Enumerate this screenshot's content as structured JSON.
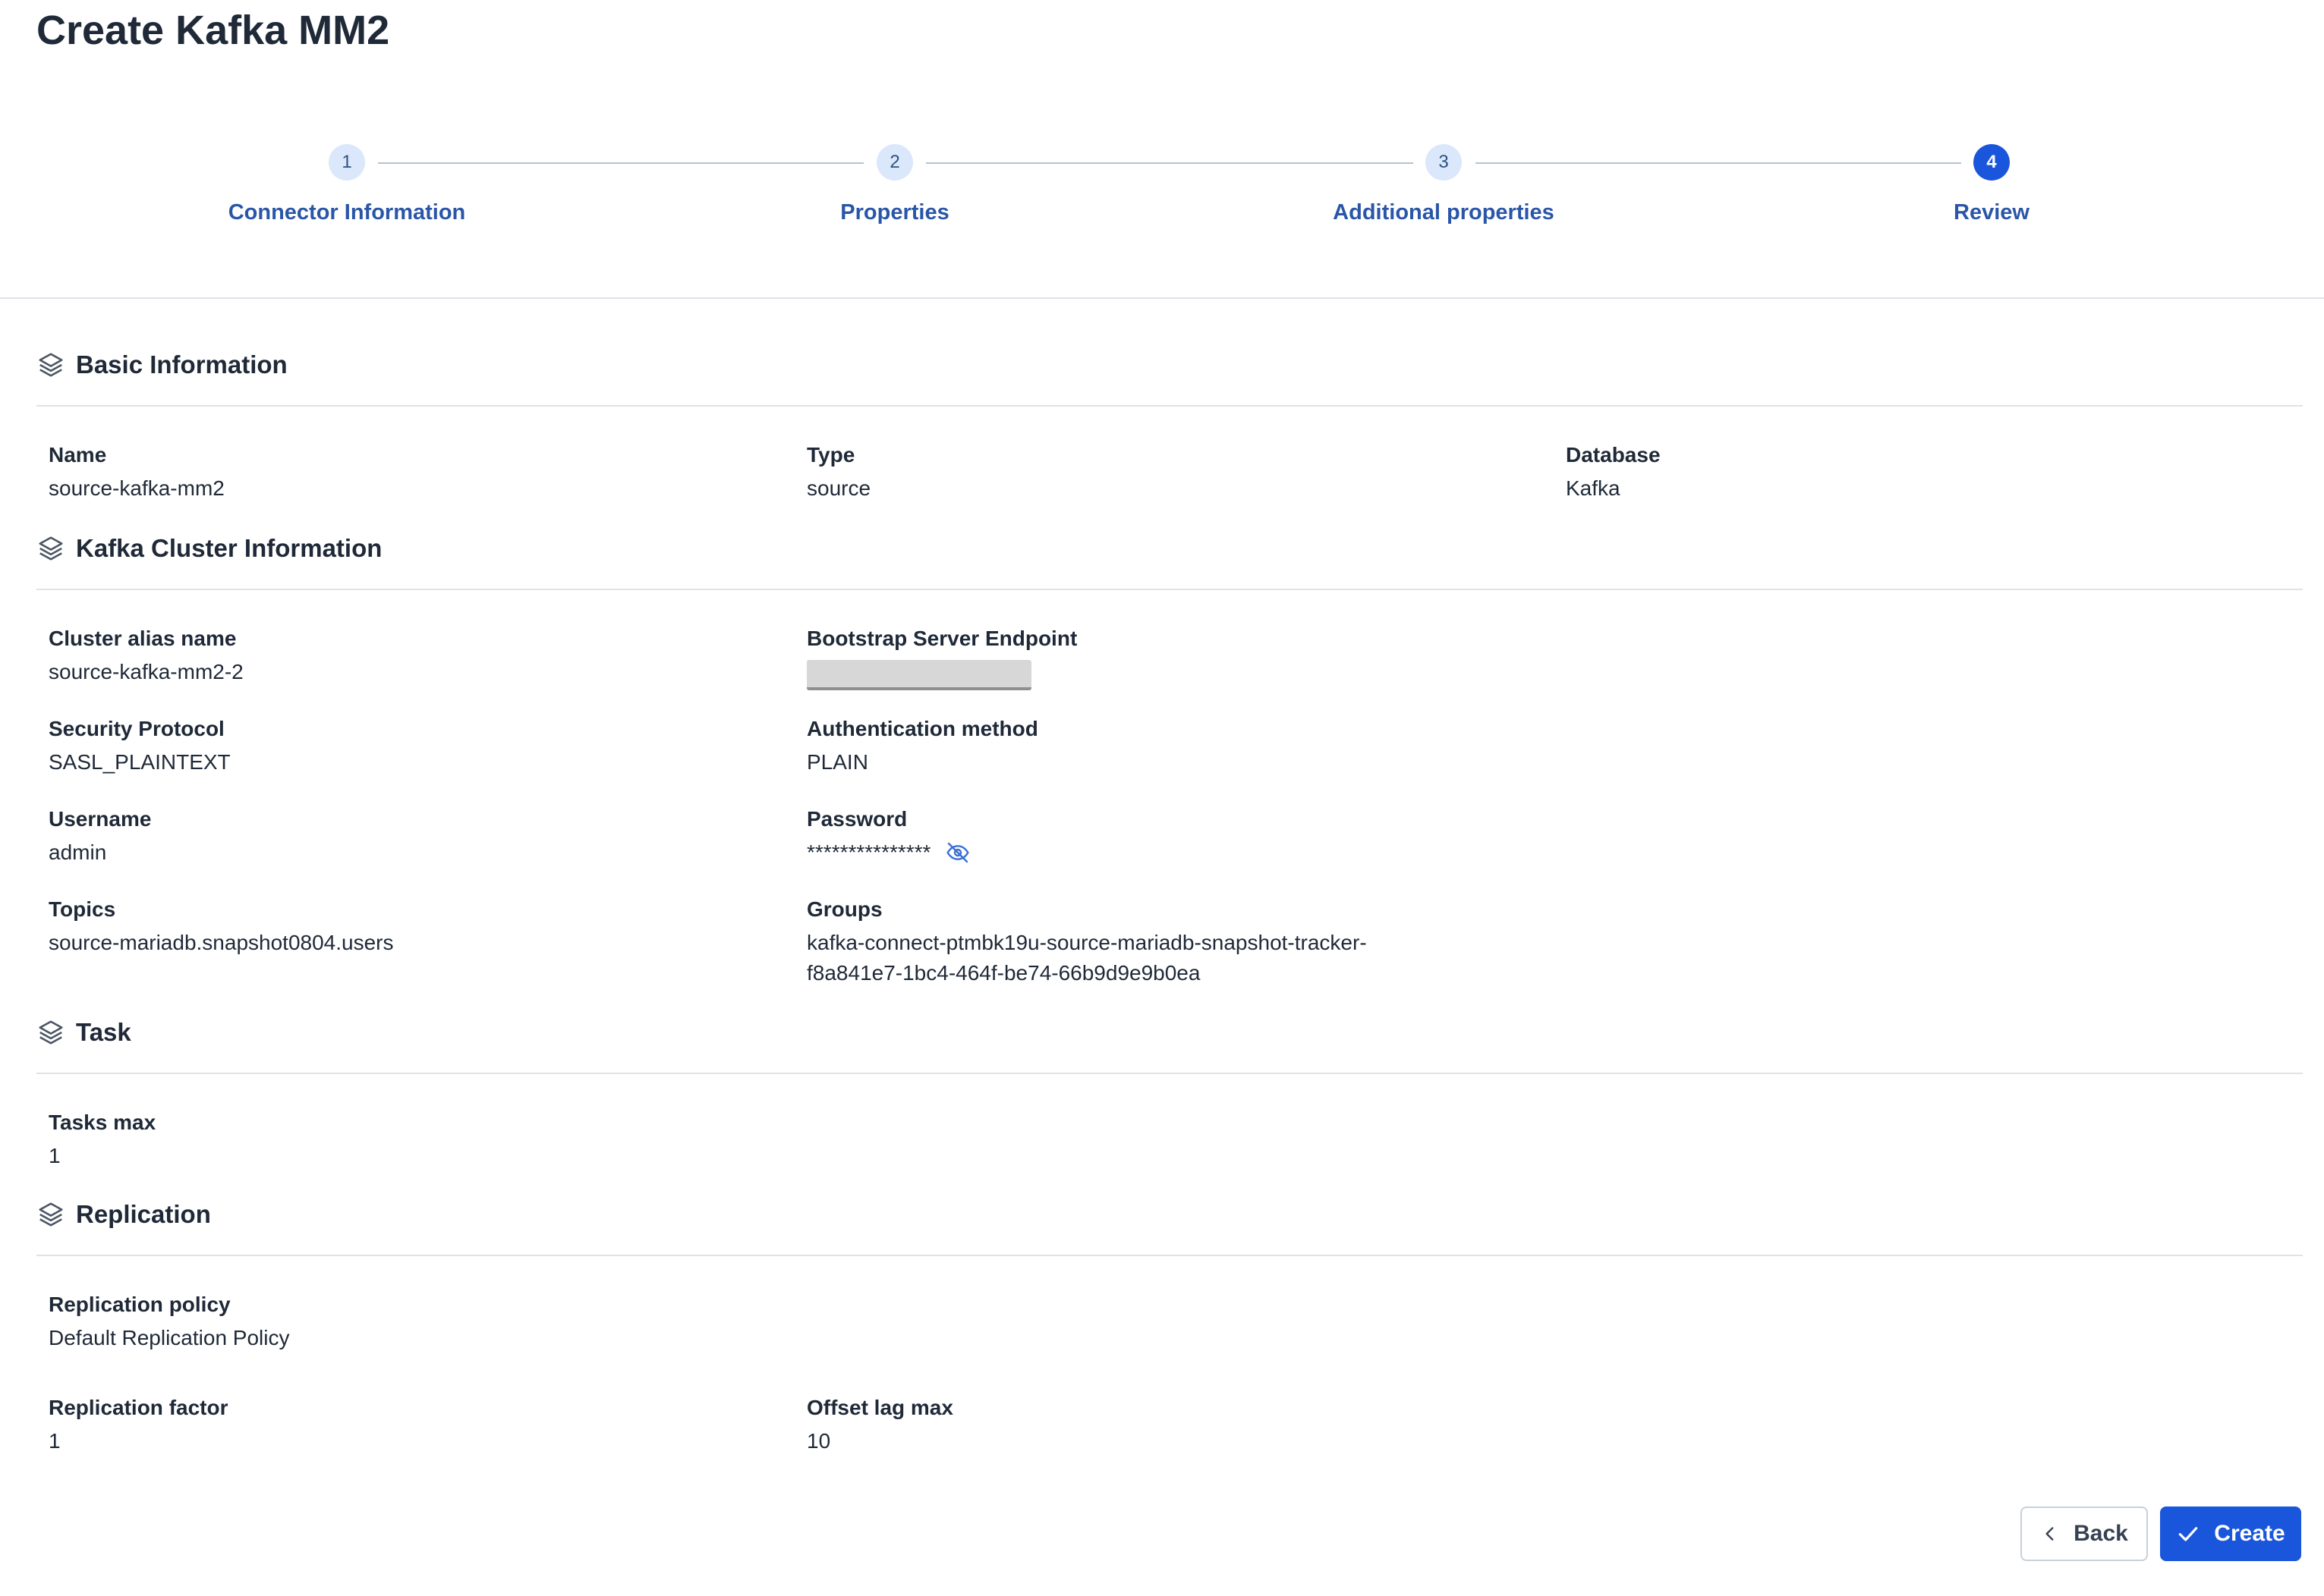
{
  "page": {
    "title": "Create Kafka MM2"
  },
  "stepper": {
    "current_step": 4,
    "steps": [
      {
        "number": "1",
        "label": "Connector Information"
      },
      {
        "number": "2",
        "label": "Properties"
      },
      {
        "number": "3",
        "label": "Additional properties"
      },
      {
        "number": "4",
        "label": "Review"
      }
    ]
  },
  "sections": {
    "basic": {
      "title": "Basic Information",
      "name": {
        "label": "Name",
        "value": "source-kafka-mm2"
      },
      "type": {
        "label": "Type",
        "value": "source"
      },
      "database": {
        "label": "Database",
        "value": "Kafka"
      }
    },
    "cluster": {
      "title": "Kafka Cluster Information",
      "alias": {
        "label": "Cluster alias name",
        "value": "source-kafka-mm2-2"
      },
      "bootstrap": {
        "label": "Bootstrap Server Endpoint"
      },
      "security": {
        "label": "Security Protocol",
        "value": "SASL_PLAINTEXT"
      },
      "auth": {
        "label": "Authentication method",
        "value": "PLAIN"
      },
      "username": {
        "label": "Username",
        "value": "admin"
      },
      "password": {
        "label": "Password",
        "value": "***************"
      },
      "topics": {
        "label": "Topics",
        "value": "source-mariadb.snapshot0804.users"
      },
      "groups": {
        "label": "Groups",
        "value_line1": "kafka-connect-ptmbk19u-source-mariadb-snapshot-tracker-",
        "value_line2": "f8a841e7-1bc4-464f-be74-66b9d9e9b0ea"
      }
    },
    "task": {
      "title": "Task",
      "tasks_max": {
        "label": "Tasks max",
        "value": "1"
      }
    },
    "replication": {
      "title": "Replication",
      "policy": {
        "label": "Replication policy",
        "value": "Default Replication Policy"
      },
      "factor": {
        "label": "Replication factor",
        "value": "1"
      },
      "offset": {
        "label": "Offset lag max",
        "value": "10"
      }
    }
  },
  "actions": {
    "back_label": "Back",
    "create_label": "Create"
  },
  "icons": {
    "section": "layers-icon",
    "password_toggle": "eye-off-icon",
    "back": "chevron-left-icon",
    "create": "check-icon"
  },
  "colors": {
    "primary": "#1a56db",
    "step_inactive_bg": "#dbe7fb",
    "step_label": "#2a56a8",
    "divider": "#dfe3e8"
  }
}
